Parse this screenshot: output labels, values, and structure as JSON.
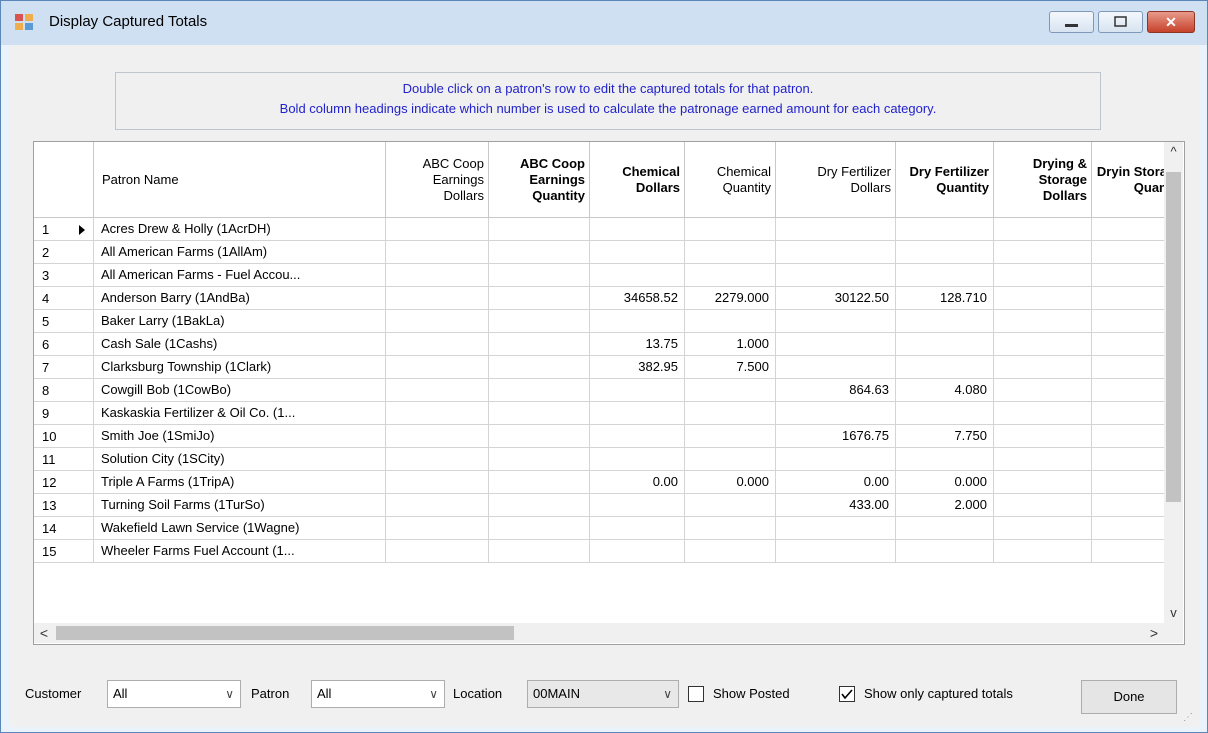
{
  "window": {
    "title": "Display Captured Totals"
  },
  "titlebar_buttons": {
    "minimize": "—",
    "maximize": "▢",
    "close": "✕"
  },
  "info": {
    "line1": "Double click on a patron's row to edit the captured totals for that patron.",
    "line2": "Bold column headings indicate which number is used to calculate the patronage earned amount for each category."
  },
  "grid": {
    "columns": [
      "Patron Name",
      "ABC Coop Earnings Dollars",
      "ABC Coop Earnings Quantity",
      "Chemical Dollars",
      "Chemical Quantity",
      "Dry Fertilizer Dollars",
      "Dry Fertilizer Quantity",
      "Drying & Storage Dollars",
      "Dryin Stora Quan"
    ],
    "rows": [
      {
        "num": "1",
        "name": "Acres Drew & Holly (1AcrDH)",
        "v": [
          "",
          "",
          "",
          "",
          "",
          "",
          "",
          ""
        ]
      },
      {
        "num": "2",
        "name": "All American Farms (1AllAm)",
        "v": [
          "",
          "",
          "",
          "",
          "",
          "",
          "",
          ""
        ]
      },
      {
        "num": "3",
        "name": "All American Farms - Fuel Accou...",
        "v": [
          "",
          "",
          "",
          "",
          "",
          "",
          "",
          ""
        ]
      },
      {
        "num": "4",
        "name": "Anderson Barry (1AndBa)",
        "v": [
          "",
          "",
          "34658.52",
          "2279.000",
          "30122.50",
          "128.710",
          "",
          ""
        ]
      },
      {
        "num": "5",
        "name": "Baker Larry (1BakLa)",
        "v": [
          "",
          "",
          "",
          "",
          "",
          "",
          "",
          ""
        ]
      },
      {
        "num": "6",
        "name": "Cash Sale (1Cashs)",
        "v": [
          "",
          "",
          "13.75",
          "1.000",
          "",
          "",
          "",
          ""
        ]
      },
      {
        "num": "7",
        "name": "Clarksburg Township (1Clark)",
        "v": [
          "",
          "",
          "382.95",
          "7.500",
          "",
          "",
          "",
          ""
        ]
      },
      {
        "num": "8",
        "name": "Cowgill Bob (1CowBo)",
        "v": [
          "",
          "",
          "",
          "",
          "864.63",
          "4.080",
          "",
          ""
        ]
      },
      {
        "num": "9",
        "name": "Kaskaskia Fertilizer & Oil Co. (1...",
        "v": [
          "",
          "",
          "",
          "",
          "",
          "",
          "",
          ""
        ]
      },
      {
        "num": "10",
        "name": "Smith Joe (1SmiJo)",
        "v": [
          "",
          "",
          "",
          "",
          "1676.75",
          "7.750",
          "",
          ""
        ]
      },
      {
        "num": "11",
        "name": "Solution City (1SCity)",
        "v": [
          "",
          "",
          "",
          "",
          "",
          "",
          "",
          ""
        ]
      },
      {
        "num": "12",
        "name": "Triple A Farms (1TripA)",
        "v": [
          "",
          "",
          "0.00",
          "0.000",
          "0.00",
          "0.000",
          "",
          ""
        ]
      },
      {
        "num": "13",
        "name": "Turning Soil Farms (1TurSo)",
        "v": [
          "",
          "",
          "",
          "",
          "433.00",
          "2.000",
          "",
          ""
        ]
      },
      {
        "num": "14",
        "name": "Wakefield Lawn Service (1Wagne)",
        "v": [
          "",
          "",
          "",
          "",
          "",
          "",
          "",
          ""
        ]
      },
      {
        "num": "15",
        "name": "Wheeler Farms Fuel Account (1...",
        "v": [
          "",
          "",
          "",
          "",
          "",
          "",
          "",
          ""
        ]
      }
    ]
  },
  "scroll": {
    "up": "^",
    "down": "v",
    "left": "<",
    "right": ">"
  },
  "filters": {
    "customer_label": "Customer",
    "customer_value": "All",
    "patron_label": "Patron",
    "patron_value": "All",
    "location_label": "Location",
    "location_value": "00MAIN",
    "show_posted_label": "Show Posted",
    "show_posted_checked": false,
    "show_captured_label": "Show only captured totals",
    "show_captured_checked": true,
    "dropdown_arrow": "∨"
  },
  "done_label": "Done"
}
